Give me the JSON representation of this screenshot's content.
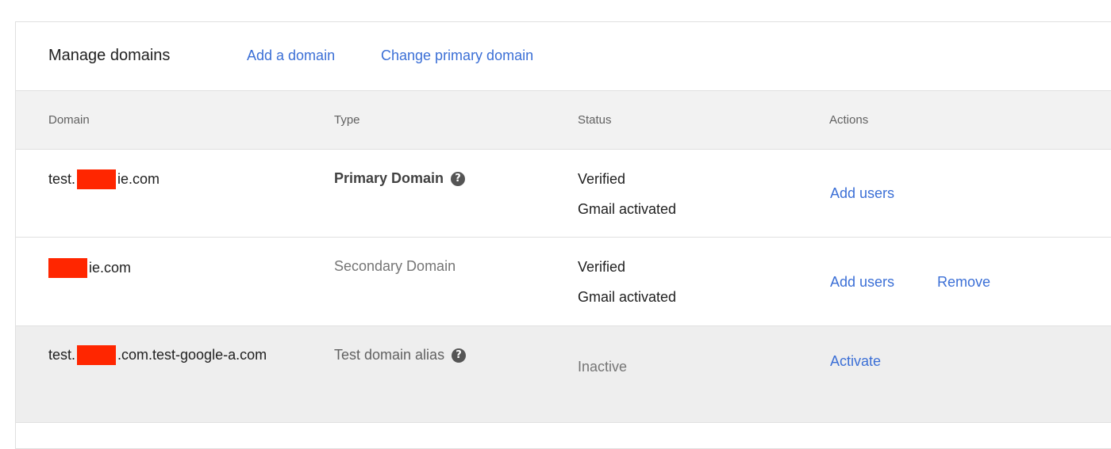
{
  "header": {
    "title": "Manage domains",
    "links": [
      "Add a domain",
      "Change primary domain"
    ]
  },
  "table": {
    "columns": [
      "Domain",
      "Type",
      "Status",
      "Actions"
    ],
    "rows": [
      {
        "domain_prefix": "test.",
        "domain_suffix": "ie.com",
        "type": "Primary Domain",
        "status": [
          "Verified",
          "Gmail activated"
        ],
        "actions": [
          "Add users"
        ]
      },
      {
        "domain_prefix": "",
        "domain_suffix": "ie.com",
        "type": "Secondary Domain",
        "status": [
          "Verified",
          "Gmail activated"
        ],
        "actions": [
          "Add users",
          "Remove"
        ]
      },
      {
        "domain_prefix": "test.",
        "domain_suffix": ".com.test-google-a.com",
        "type": "Test domain alias",
        "status": [
          "Inactive"
        ],
        "actions": [
          "Activate"
        ]
      }
    ]
  },
  "icons": {
    "help": "help-circle-icon",
    "help_glyph": "?"
  },
  "colors": {
    "link": "#3b6fd6",
    "header_bg": "#f2f2f2",
    "redaction": "#ff2600",
    "inactive_row_bg": "#eeeeee"
  }
}
